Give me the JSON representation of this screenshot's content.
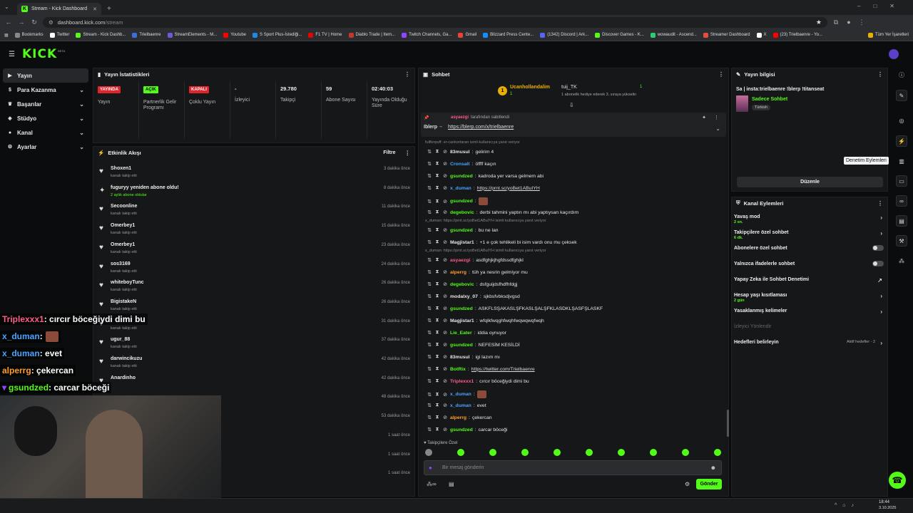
{
  "browser": {
    "tab_title": "Stream - Kick Dashboard",
    "url_host": "dashboard.kick.com",
    "url_path": "/stream",
    "bookmarks": [
      "Bookmarks",
      "Twitter",
      "Stream - Kick Dashb...",
      "Trielbaenre",
      "StreamElements - M...",
      "Youtube",
      "S Sport Plus-İstediği...",
      "F1 TV | Home",
      "Diablo Trade | Item...",
      "Twitch Channels, Ga...",
      "Gmail",
      "Blizzard Press Cente...",
      "(1342) Discord | Ark...",
      "Discover Games - K...",
      "wowaudit - Ascend...",
      "Streamer Dashboard",
      "X",
      "(23) Trielbaenre - Yo...",
      "Tüm Yer İşaretleri"
    ],
    "bookmark_colors": [
      "#888888",
      "#ffffff",
      "#53fc18",
      "#3b6ed6",
      "#6b5bd6",
      "#ff0000",
      "#1e88e5",
      "#e10600",
      "#c0392b",
      "#9146ff",
      "#ea4335",
      "#148eff",
      "#5865f2",
      "#53fc18",
      "#2ecc71",
      "#e74c3c",
      "#ffffff",
      "#ff0000",
      "#e8b100"
    ]
  },
  "header": {
    "logo": "KICK",
    "logo_sup": "BETA"
  },
  "sidebar": {
    "items": [
      {
        "label": "Yayın",
        "icon": "video-icon",
        "active": true
      },
      {
        "label": "Para Kazanma",
        "icon": "money-icon"
      },
      {
        "label": "Başarılar",
        "icon": "trophy-icon"
      },
      {
        "label": "Stüdyo",
        "icon": "studio-icon"
      },
      {
        "label": "Kanal",
        "icon": "user-icon"
      },
      {
        "label": "Ayarlar",
        "icon": "gear-icon"
      }
    ]
  },
  "stats": {
    "title": "Yayın İstatistikleri",
    "cells": [
      {
        "badge": "YAYINDA",
        "badge_color": "#e0242c",
        "label": "Yayın"
      },
      {
        "badge": "AÇIK",
        "badge_color": "#53fc18",
        "label": "Partnerlik Gelir Programı"
      },
      {
        "badge": "KAPALI",
        "badge_color": "#e0242c",
        "label": "Çoklu Yayın"
      },
      {
        "value": "-",
        "label": "İzleyici"
      },
      {
        "value": "29.780",
        "label": "Takipçi"
      },
      {
        "value": "59",
        "label": "Abone Sayısı"
      },
      {
        "value": "02:40:03",
        "label": "Yayında Olduğu Süre"
      }
    ]
  },
  "activity": {
    "title": "Etkinlik Akışı",
    "filter": "Filtre",
    "events": [
      {
        "name": "Shoxen1",
        "sub": "kanalı takip etti",
        "time": "3 dakika önce"
      },
      {
        "name": "fuguryy yeniden abone oldu!",
        "sub": "2 aylık abone oldular",
        "time": "8 dakika önce",
        "special": true
      },
      {
        "name": "Secoonline",
        "sub": "kanalı takip etti",
        "time": "11 dakika önce"
      },
      {
        "name": "Omerbey1",
        "sub": "kanalı takip etti",
        "time": "15 dakika önce"
      },
      {
        "name": "Omerbey1",
        "sub": "kanalı takip etti",
        "time": "23 dakika önce"
      },
      {
        "name": "sos3169",
        "sub": "kanalı takip etti",
        "time": "24 dakika önce"
      },
      {
        "name": "whiteboyTunc",
        "sub": "kanalı takip etti",
        "time": "26 dakika önce"
      },
      {
        "name": "BigistakeN",
        "sub": "kanalı takip etti",
        "time": "26 dakika önce"
      },
      {
        "name": "",
        "sub": "kanalı takip etti",
        "time": "31 dakika önce"
      },
      {
        "name": "ugur_88",
        "sub": "kanalı takip etti",
        "time": "37 dakika önce"
      },
      {
        "name": "darwincikuzu",
        "sub": "kanalı takip etti",
        "time": "42 dakika önce"
      },
      {
        "name": "Anardinho",
        "sub": "",
        "time": "42 dakika önce"
      },
      {
        "name": "",
        "sub": "",
        "time": "48 dakika önce"
      },
      {
        "name": "",
        "sub": "",
        "time": "53 dakika önce"
      },
      {
        "name": "",
        "sub": "",
        "time": "1 saat önce"
      },
      {
        "name": "",
        "sub": "",
        "time": "1 saat önce"
      },
      {
        "name": "",
        "sub": "",
        "time": "1 saat önce"
      }
    ]
  },
  "chat": {
    "title": "Sohbet",
    "pinned_gift_user": "Ucanhollandalim",
    "pinned_gift_count": "1",
    "pinned_gift_text": "1 abonelik hediye ederek 3. sıraya yükselin",
    "pinned_gift_user2": "tuij_TK",
    "pinned_gift_count2": "1",
    "pinned_by_user": "asyaezgi",
    "pinned_by_text": "tarafından sabitlendi",
    "pinned_msg_user": "Iblerp",
    "pinned_msg_link": "https://blerp.com/x/trielbaenre",
    "messages": [
      {
        "type": "reply",
        "text": "fullferpuff: er-cankortaran ismli kullanıcıya yanıt veriyor"
      },
      {
        "user": "83musul",
        "color": "#e6e6e6",
        "text": "gelirim 4"
      },
      {
        "user": "Cronsalt",
        "color": "#4aa3ff",
        "text": "öffff kaçın"
      },
      {
        "user": "gsundzed",
        "color": "#53fc18",
        "text": "kadroda yer varsa gelmem abi"
      },
      {
        "user": "x_duman",
        "color": "#4aa3ff",
        "link": "https://prnt.sc/yoBet1ABuIYH"
      },
      {
        "user": "gsundzed",
        "color": "#53fc18",
        "emote": true
      },
      {
        "user": "degebovic",
        "color": "#53fc18",
        "text": "derbi tahmini yaptın mı abi yaptıysan kaçırdım"
      },
      {
        "type": "reply",
        "text": "x_duman: https://prnt.sc/yoBet1ABuIYH isimli kullanıcıya yanıt veriyor"
      },
      {
        "user": "gsundzed",
        "color": "#53fc18",
        "text": "bu ne lan"
      },
      {
        "user": "Magjistar1",
        "color": "#e6e6e6",
        "text": "+1 e çok tehlikeli bi isim vardı onu mu çeksek"
      },
      {
        "type": "reply",
        "text": "x_duman: https://prnt.sc/yoBet1ABuIYH isimli kullanıcıya yanıt veriyor"
      },
      {
        "user": "asyaezgi",
        "color": "#ff5c8a",
        "text": "asdfghjkjhgfdssdfghjkl"
      },
      {
        "user": "alperrg",
        "color": "#ff9d2e",
        "text": "tüh ya nesrin gelmiyor mu"
      },
      {
        "user": "degebovic",
        "color": "#53fc18",
        "text": "dsfguijdsfhdfhfdgj"
      },
      {
        "user": "modalxy_07",
        "color": "#e6e6e6",
        "text": "sjkbsfvbksdjvgsd"
      },
      {
        "user": "gsundzed",
        "color": "#53fc18",
        "text": "ASKFLSŞAKASLŞFKASLŞALŞFKLASDKLŞASFŞLASKF"
      },
      {
        "user": "Magjistar1",
        "color": "#e6e6e6",
        "text": "wfqlkfwqghfwqhfwqwqwqfwqh"
      },
      {
        "user": "Lie_Eater",
        "color": "#53fc18",
        "text": "iddia oynuyor"
      },
      {
        "user": "gsundzed",
        "color": "#53fc18",
        "text": "NEFESİM KESİLDİ"
      },
      {
        "user": "83musul",
        "color": "#e6e6e6",
        "text": "igi lazım mı"
      },
      {
        "user": "BotRix",
        "color": "#53fc18",
        "link": "https://twitter.com/Trielbaenre"
      },
      {
        "user": "Triplexxx1",
        "color": "#ff5c8a",
        "text": "cırcır böceğiydi dimi bu"
      },
      {
        "user": "x_duman",
        "color": "#4aa3ff",
        "emote": true
      },
      {
        "user": "x_duman",
        "color": "#4aa3ff",
        "text": "evet"
      },
      {
        "user": "alperrg",
        "color": "#ff9d2e",
        "text": "çekercan"
      },
      {
        "user": "gsundzed",
        "color": "#53fc18",
        "text": "carcar böceği"
      }
    ],
    "followers_only": "Takipçilere Özel",
    "input_placeholder": "Bir mesaj gönderin",
    "send": "Gönder"
  },
  "stream_info": {
    "title": "Yayın bilgisi",
    "stream_title": "Sa | insta:trielbaenre !blerp !titanseat",
    "category": "Sadece Sohbet",
    "tag": "Türkish",
    "edit": "Düzenle",
    "tooltip": "Denetim Eylemleri"
  },
  "channel_actions": {
    "title": "Kanal Eylemleri",
    "items": [
      {
        "label": "Yavaş mod",
        "sub": "2 sn.",
        "control": "arrow"
      },
      {
        "label": "Takipçilere özel sohbet",
        "sub": "6 dk.",
        "control": "arrow"
      },
      {
        "label": "Abonelere özel sohbet",
        "control": "toggle"
      },
      {
        "label": "Yalnızca ifadelerle sohbet",
        "control": "toggle"
      },
      {
        "label": "Yapay Zeka ile Sohbet Denetimi",
        "control": "external"
      },
      {
        "label": "Hesap yaşı kısıtlaması",
        "sub": "2 gün",
        "control": "arrow"
      },
      {
        "label": "Yasaklanmış kelimeler",
        "control": "arrow"
      },
      {
        "label": "İzleyici Yönlendir",
        "control": "none",
        "disabled": true
      },
      {
        "label": "Hedefleri belirleyin",
        "control": "arrow",
        "status": "Aktif hedefler - 2"
      }
    ]
  },
  "overlay": [
    {
      "user": "Triplexxx1",
      "color": "#ff5c8a",
      "text": ": cırcır böceğiydi dimi bu"
    },
    {
      "user": "x_duman",
      "color": "#4aa3ff",
      "text": ":",
      "emote": true
    },
    {
      "user": "x_duman",
      "color": "#4aa3ff",
      "text": ": evet"
    },
    {
      "user": "alperrg",
      "color": "#ff9d2e",
      "text": ": çekercan"
    },
    {
      "user": "gsundzed",
      "color": "#53fc18",
      "text": ": carcar böceği",
      "badge": true
    }
  ],
  "taskbar": {
    "time": "18:44",
    "date": "3.10.2025"
  }
}
